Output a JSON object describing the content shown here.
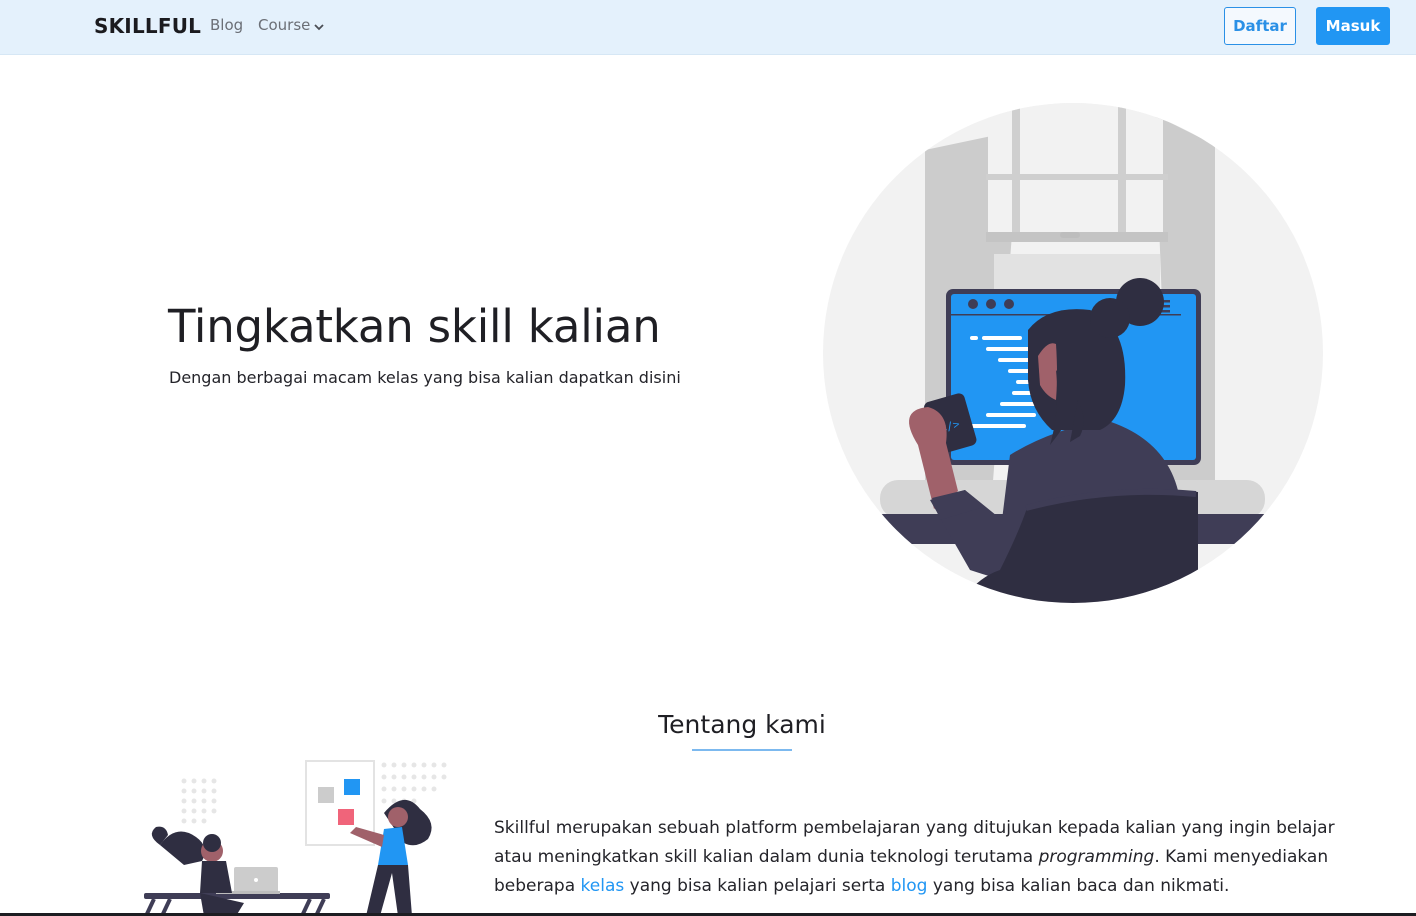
{
  "navbar": {
    "brand": "SKILLFUL",
    "links": {
      "blog": "Blog",
      "course": "Course"
    },
    "register_label": "Daftar",
    "login_label": "Masuk"
  },
  "hero": {
    "title": "Tingkatkan skill kalian",
    "subtitle": "Dengan berbagai macam kelas yang bisa kalian dapatkan disini",
    "monitor_code_symbol": "</>"
  },
  "about": {
    "title": "Tentang kami",
    "text_1": "Skillful merupakan sebuah platform pembelajaran yang ditujukan kepada kalian yang ingin belajar atau meningkatkan skill kalian dalam dunia teknologi terutama ",
    "text_em": "programming",
    "text_2": ". Kami menyediakan beberapa ",
    "link_kelas": "kelas",
    "text_3": " yang bisa kalian pelajari serta ",
    "link_blog": "blog",
    "text_4": " yang bisa kalian baca dan nikmati."
  },
  "colors": {
    "accent": "#2196f3",
    "navbar_bg": "#e4f1fc",
    "illustration_dark": "#2f2e41",
    "illustration_gray": "#cccccc",
    "illustration_pink": "#f0647a"
  }
}
